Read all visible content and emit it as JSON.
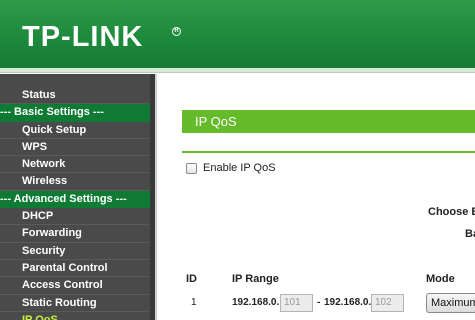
{
  "brand": {
    "logo_text": "TP-LINK",
    "registered_mark": "R"
  },
  "colors": {
    "header_green": "#1d8a3c",
    "section_green": "#0e7a33",
    "title_bar_green": "#66bb2a",
    "active_item": "#c8f23a",
    "sidebar_bg": "#4a4a4a"
  },
  "sidebar": {
    "items": [
      {
        "label": "Status",
        "type": "item"
      },
      {
        "label": "--- Basic Settings ---",
        "type": "section"
      },
      {
        "label": "Quick Setup",
        "type": "item"
      },
      {
        "label": "WPS",
        "type": "item"
      },
      {
        "label": "Network",
        "type": "item"
      },
      {
        "label": "Wireless",
        "type": "item"
      },
      {
        "label": "--- Advanced Settings ---",
        "type": "section"
      },
      {
        "label": "DHCP",
        "type": "item"
      },
      {
        "label": "Forwarding",
        "type": "item"
      },
      {
        "label": "Security",
        "type": "item"
      },
      {
        "label": "Parental Control",
        "type": "item"
      },
      {
        "label": "Access Control",
        "type": "item"
      },
      {
        "label": "Static Routing",
        "type": "item"
      },
      {
        "label": "IP QoS",
        "type": "item"
      }
    ]
  },
  "main": {
    "title": "IP QoS",
    "enable_label": "Enable IP QoS",
    "enable_checked": false,
    "bandwidth_label_1": "Choose B",
    "bandwidth_label_2": "Ba",
    "table": {
      "headers": {
        "id": "ID",
        "ip_range": "IP Range",
        "mode": "Mode"
      },
      "rows": [
        {
          "id": "1",
          "ip_prefix_start": "192.168.0.",
          "ip_start": "101",
          "separator": "-",
          "ip_prefix_end": "192.168.0.",
          "ip_end": "102",
          "mode": "Maximum"
        }
      ]
    }
  }
}
